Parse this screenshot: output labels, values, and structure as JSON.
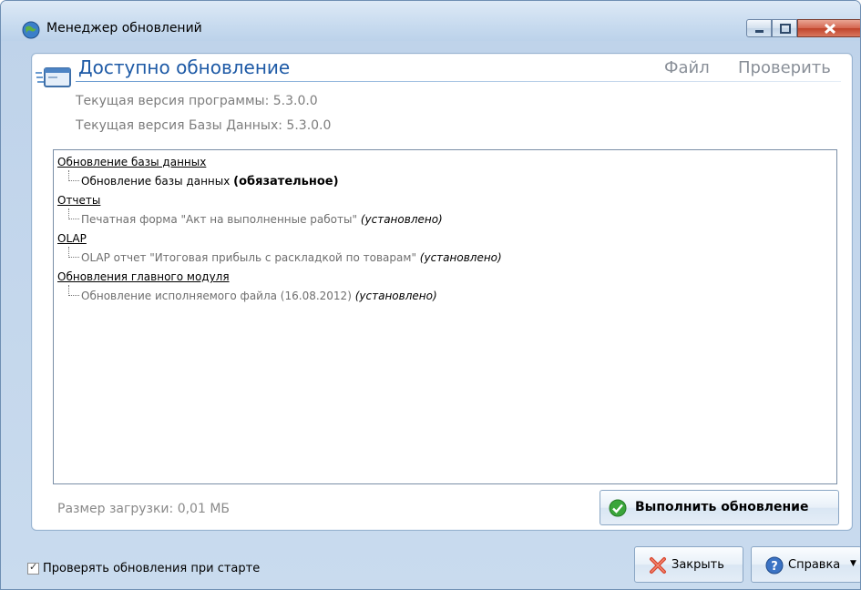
{
  "window": {
    "title": "Менеджер обновлений"
  },
  "header": {
    "title": "Доступно обновление",
    "menu": {
      "file": "Файл",
      "check": "Проверить"
    }
  },
  "versions": {
    "program": "Текущая версия программы: 5.3.0.0",
    "database": "Текущая версия Базы Данных: 5.3.0.0"
  },
  "tree": [
    {
      "category": "Обновление базы данных",
      "item": "Обновление базы данных",
      "status": "(обязательное)"
    },
    {
      "category": "Отчеты",
      "item": "Печатная форма \"Акт на выполненные работы\"",
      "status": "(установлено)"
    },
    {
      "category": "OLAP",
      "item": "OLAP отчет \"Итоговая прибыль с раскладкой по товарам\"",
      "status": "(установлено)"
    },
    {
      "category": "Обновления главного модуля",
      "item": "Обновление исполняемого файла (16.08.2012)",
      "status": "(установлено)"
    }
  ],
  "footer": {
    "download_size": "Размер загрузки: 0,01 МБ",
    "update_button": "Выполнить обновление",
    "check_on_startup": "Проверять обновления при старте",
    "check_on_startup_checked": true,
    "close_button": "Закрыть",
    "help_button": "Справка"
  },
  "colors": {
    "accent": "#1e5aa6",
    "ok_green": "#3aa53a",
    "close_red": "#d9432b"
  }
}
